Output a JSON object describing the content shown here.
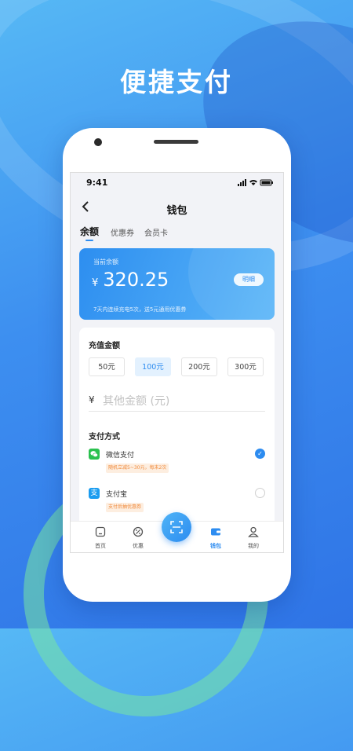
{
  "headline": "便捷支付",
  "status_bar": {
    "time": "9:41"
  },
  "nav": {
    "title": "钱包"
  },
  "tabs": [
    {
      "label": "余额",
      "active": true
    },
    {
      "label": "优惠券",
      "active": false
    },
    {
      "label": "会员卡",
      "active": false
    }
  ],
  "balance_card": {
    "label": "当前余额",
    "currency": "¥",
    "amount": "320.25",
    "detail_button": "明细",
    "note": "7天内连续充电5次，送5元通用优惠券"
  },
  "recharge": {
    "title": "充值金额",
    "amounts": [
      {
        "label": "50元",
        "selected": false
      },
      {
        "label": "100元",
        "selected": true
      },
      {
        "label": "200元",
        "selected": false
      },
      {
        "label": "300元",
        "selected": false
      }
    ],
    "currency": "¥",
    "other_placeholder": "其他金额 (元)"
  },
  "payment": {
    "title": "支付方式",
    "methods": [
      {
        "name": "微信支付",
        "promo": "随机立减5~30元，每末2次",
        "selected": true,
        "icon": "wechat-pay-icon",
        "color": "#2bc14f"
      },
      {
        "name": "支付宝",
        "promo": "支付后抽优惠券",
        "selected": false,
        "icon": "alipay-icon",
        "color": "#1a9cf0"
      }
    ]
  },
  "tabbar": {
    "items": [
      {
        "label": "首页",
        "icon": "home-icon",
        "active": false
      },
      {
        "label": "优惠",
        "icon": "discount-icon",
        "active": false
      },
      {
        "label": "钱包",
        "icon": "wallet-icon",
        "active": true
      },
      {
        "label": "我的",
        "icon": "user-icon",
        "active": false
      }
    ],
    "center_icon": "scan-icon"
  },
  "colors": {
    "accent": "#2d8cf0",
    "promo_text": "#f08a3c",
    "wechat": "#2bc14f",
    "alipay": "#1a9cf0"
  }
}
